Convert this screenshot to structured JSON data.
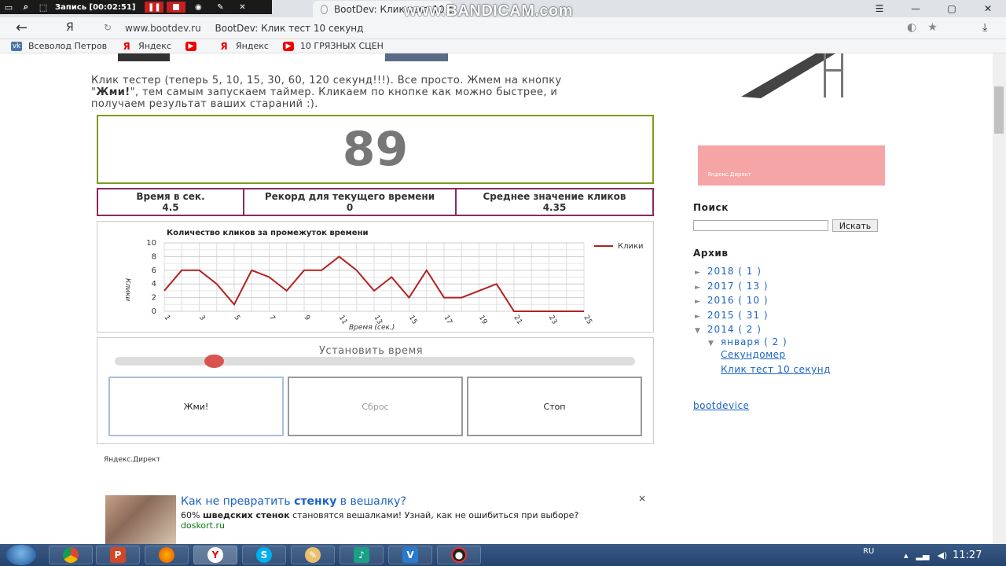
{
  "recorder": {
    "label": "Запись [00:02:51]"
  },
  "watermark": "www.BANDICAM.com",
  "tab": {
    "title": "BootDev: Клик тест 10 с"
  },
  "address": {
    "domain": "www.bootdev.ru",
    "title": "BootDev: Клик тест 10 секунд",
    "ya": "Я"
  },
  "bookmarks": [
    {
      "label": "Всеволод Петров",
      "icon": "vk-icon"
    },
    {
      "label": "Яндекс",
      "icon": "yandex-icon"
    },
    {
      "label": "",
      "icon": "youtube-icon"
    },
    {
      "label": "Яндекс",
      "icon": "yandex-icon"
    },
    {
      "label": "10 ГРЯЗНЫХ СЦЕН",
      "icon": "youtube-icon"
    }
  ],
  "intro": {
    "line1": "Клик тестер (теперь 5, 10, 15, 30, 60, 120 секунд!!!). Все просто. Жмем на кнопку",
    "quote_open": "\"",
    "bold": "Жми!",
    "line2": "\", тем самым запускаем таймер. Кликаем по кнопке как можно быстрее, и",
    "line3": "получаем результат ваших стараний :)."
  },
  "counter": "89",
  "stats": {
    "time_label": "Время в сек.",
    "time_value": "4.5",
    "record_label": "Рекорд для текущего времени",
    "record_value": "0",
    "avg_label": "Среднее значение кликов",
    "avg_value": "4.35"
  },
  "chart_data": {
    "type": "line",
    "title": "Количество кликов за промежуток времени",
    "xlabel": "Время (сек.)",
    "ylabel": "Клики",
    "x": [
      1,
      2,
      3,
      4,
      5,
      6,
      7,
      8,
      9,
      10,
      11,
      12,
      13,
      14,
      15,
      16,
      17,
      18,
      19,
      20,
      21,
      22,
      23,
      24,
      25
    ],
    "xticks": [
      "1",
      "3",
      "5",
      "7",
      "9",
      "11",
      "13",
      "15",
      "17",
      "19",
      "21",
      "23",
      "25"
    ],
    "yticks": [
      "0",
      "2",
      "4",
      "6",
      "8",
      "10"
    ],
    "ylim": [
      0,
      10
    ],
    "series": [
      {
        "name": "Клики",
        "color": "#b22222",
        "values": [
          3,
          6,
          6,
          4,
          1,
          6,
          5,
          3,
          6,
          6,
          8,
          6,
          3,
          5,
          2,
          6,
          2,
          2,
          3,
          4,
          0,
          0,
          0,
          0,
          0
        ]
      }
    ],
    "grid": true,
    "legend": "top-right"
  },
  "controls": {
    "set_time": "Установить время",
    "slider_position": 0.19,
    "press": "Жми!",
    "reset": "Сброс",
    "stop": "Стоп"
  },
  "yandex_direct": "Яндекс.Директ",
  "ad": {
    "title_pre": "Как не превратить ",
    "title_bold": "стенку",
    "title_post": " в вешалку?",
    "text_pre": "60% ",
    "text_bold": "шведских стенок",
    "text_post": " становятся вешалками! Узнай, как не ошибиться при выборе?",
    "domain": "doskort.ru",
    "close": "×"
  },
  "sidebar": {
    "img_caption": "Яндекс.Директ",
    "search_title": "Поиск",
    "search_button": "Искать",
    "archive_title": "Архив",
    "archive": [
      {
        "label": "2018",
        "count": "( 1 )"
      },
      {
        "label": "2017",
        "count": "( 13 )"
      },
      {
        "label": "2016",
        "count": "( 10 )"
      },
      {
        "label": "2015",
        "count": "( 31 )"
      },
      {
        "label": "2014",
        "count": "( 2 )"
      }
    ],
    "month": {
      "label": "января",
      "count": "( 2 )"
    },
    "posts": [
      "Секундомер",
      "Клик тест 10 секунд"
    ],
    "profile": "bootdevice"
  },
  "taskbar": {
    "lang": "RU",
    "time": "11:27"
  }
}
